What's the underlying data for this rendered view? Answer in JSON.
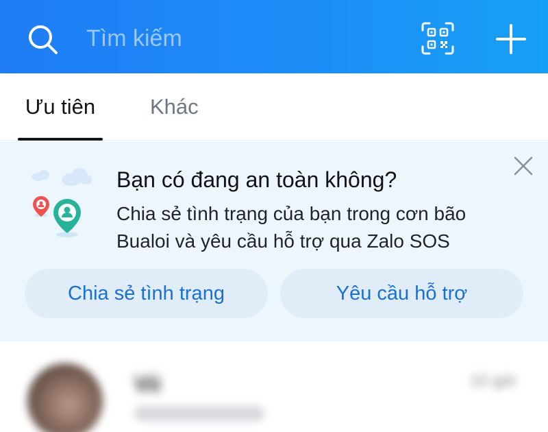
{
  "header": {
    "search_placeholder": "Tìm kiếm",
    "icons": [
      "search-icon",
      "qr-code-icon",
      "plus-icon"
    ]
  },
  "tabs": [
    {
      "label": "Ưu tiên",
      "active": true
    },
    {
      "label": "Khác",
      "active": false
    }
  ],
  "banner": {
    "title": "Bạn có đang an toàn không?",
    "description": "Chia sẻ tình trạng của bạn trong cơn bão Bualoi và yêu cầu hỗ trợ qua Zalo SOS",
    "buttons": {
      "share": "Chia sẻ tình trạng",
      "help": "Yêu cầu hỗ trợ"
    }
  },
  "chat": {
    "name": "Vii",
    "time": "10 giờ"
  },
  "colors": {
    "header_gradient_start": "#1f7cf6",
    "header_gradient_end": "#17a0f6",
    "banner_bg": "#eef6fd",
    "button_bg": "#e0edf9",
    "button_text": "#1a6fd4"
  }
}
